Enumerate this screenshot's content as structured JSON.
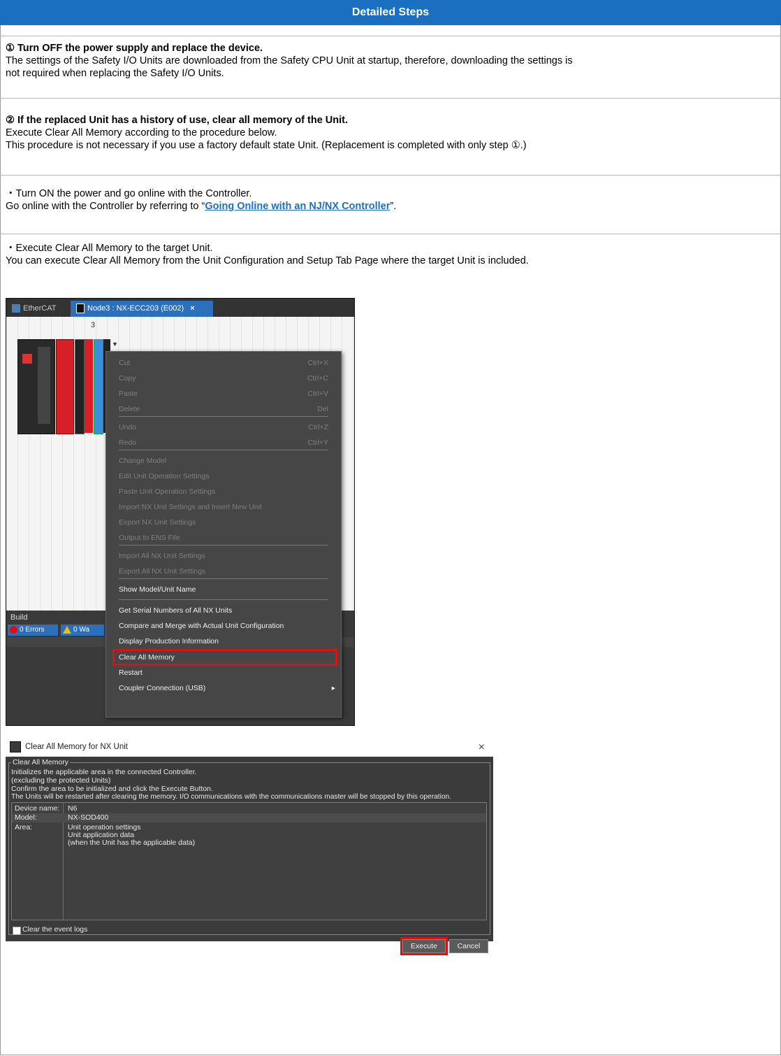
{
  "header": {
    "title": "Detailed Steps"
  },
  "step1": {
    "heading": "① Turn OFF the power supply and replace the device.",
    "line1": "The settings of the Safety I/O Units are downloaded from the Safety CPU Unit at startup, therefore, downloading the settings is",
    "line2": "not required when replacing the Safety I/O Units."
  },
  "step2": {
    "heading": "② If the replaced Unit has a history of use, clear all memory of the Unit.",
    "line1": "Execute Clear All Memory according to the procedure below.",
    "line2": "This procedure is not necessary if you use a factory default state Unit. (Replacement is completed with only step ①.)",
    "bullet1": "・Turn ON the power and go online with the Controller.",
    "go_prefix": "Go online with the Controller by referring to “",
    "go_link": "Going Online with an NJ/NX Controller",
    "go_suffix": "”.",
    "bullet2": "・Execute Clear All Memory to the target Unit.",
    "line3": "You can execute Clear All Memory from the Unit Configuration and Setup Tab Page where the target Unit is included."
  },
  "shot1": {
    "tab1": "EtherCAT",
    "tab2": "Node3 : NX-ECC203 (E002)",
    "tab_close": "×",
    "slot_number": "3",
    "build_label": "Build",
    "errors": "0 Errors",
    "warnings": "0 Wa",
    "menu": [
      {
        "label": "Cut",
        "shortcut": "Ctrl+X"
      },
      {
        "label": "Copy",
        "shortcut": "Ctrl+C"
      },
      {
        "label": "Paste",
        "shortcut": "Ctrl+V"
      },
      {
        "label": "Delete",
        "shortcut": "Del"
      },
      {
        "label": "Undo",
        "shortcut": "Ctrl+Z"
      },
      {
        "label": "Redo",
        "shortcut": "Ctrl+Y"
      },
      {
        "label": "Change Model"
      },
      {
        "label": "Edit Unit Operation Settings"
      },
      {
        "label": "Paste Unit Operation Settings"
      },
      {
        "label": "Import NX Unit Settings and Insert New Unit"
      },
      {
        "label": "Export NX Unit Settings"
      },
      {
        "label": "Output to ENS File"
      },
      {
        "label": "Import All NX Unit Settings"
      },
      {
        "label": "Export All NX Unit Settings"
      },
      {
        "label": "Show Model/Unit Name"
      },
      {
        "label": "Get Serial Numbers of All NX Units"
      },
      {
        "label": "Compare and Merge with Actual Unit Configuration"
      },
      {
        "label": "Display Production Information"
      },
      {
        "label": "Clear All Memory"
      },
      {
        "label": "Restart"
      },
      {
        "label": "Coupler Connection (USB)"
      }
    ],
    "submenu_arrow": "▸"
  },
  "shot2": {
    "title": "Clear All Memory for NX Unit",
    "close": "×",
    "group": "Clear All Memory",
    "desc1": "Initializes the applicable area in the connected Controller.",
    "desc2": "(excluding the protected Units)",
    "desc3": "Confirm the area to be initialized and click the Execute Button.",
    "desc4": "The Units will be restarted after clearing the memory. I/O communications with the communications master will be stopped by this operation.",
    "rows": [
      {
        "k": "Device name:",
        "v": "N6"
      },
      {
        "k": "Model:",
        "v": "NX-SOD400"
      },
      {
        "k": "Area:",
        "v": "Unit operation settings"
      }
    ],
    "area2": "Unit application data",
    "area3": "(when the Unit has the applicable data)",
    "checkbox": "Clear the event logs",
    "execute": "Execute",
    "cancel": "Cancel"
  }
}
